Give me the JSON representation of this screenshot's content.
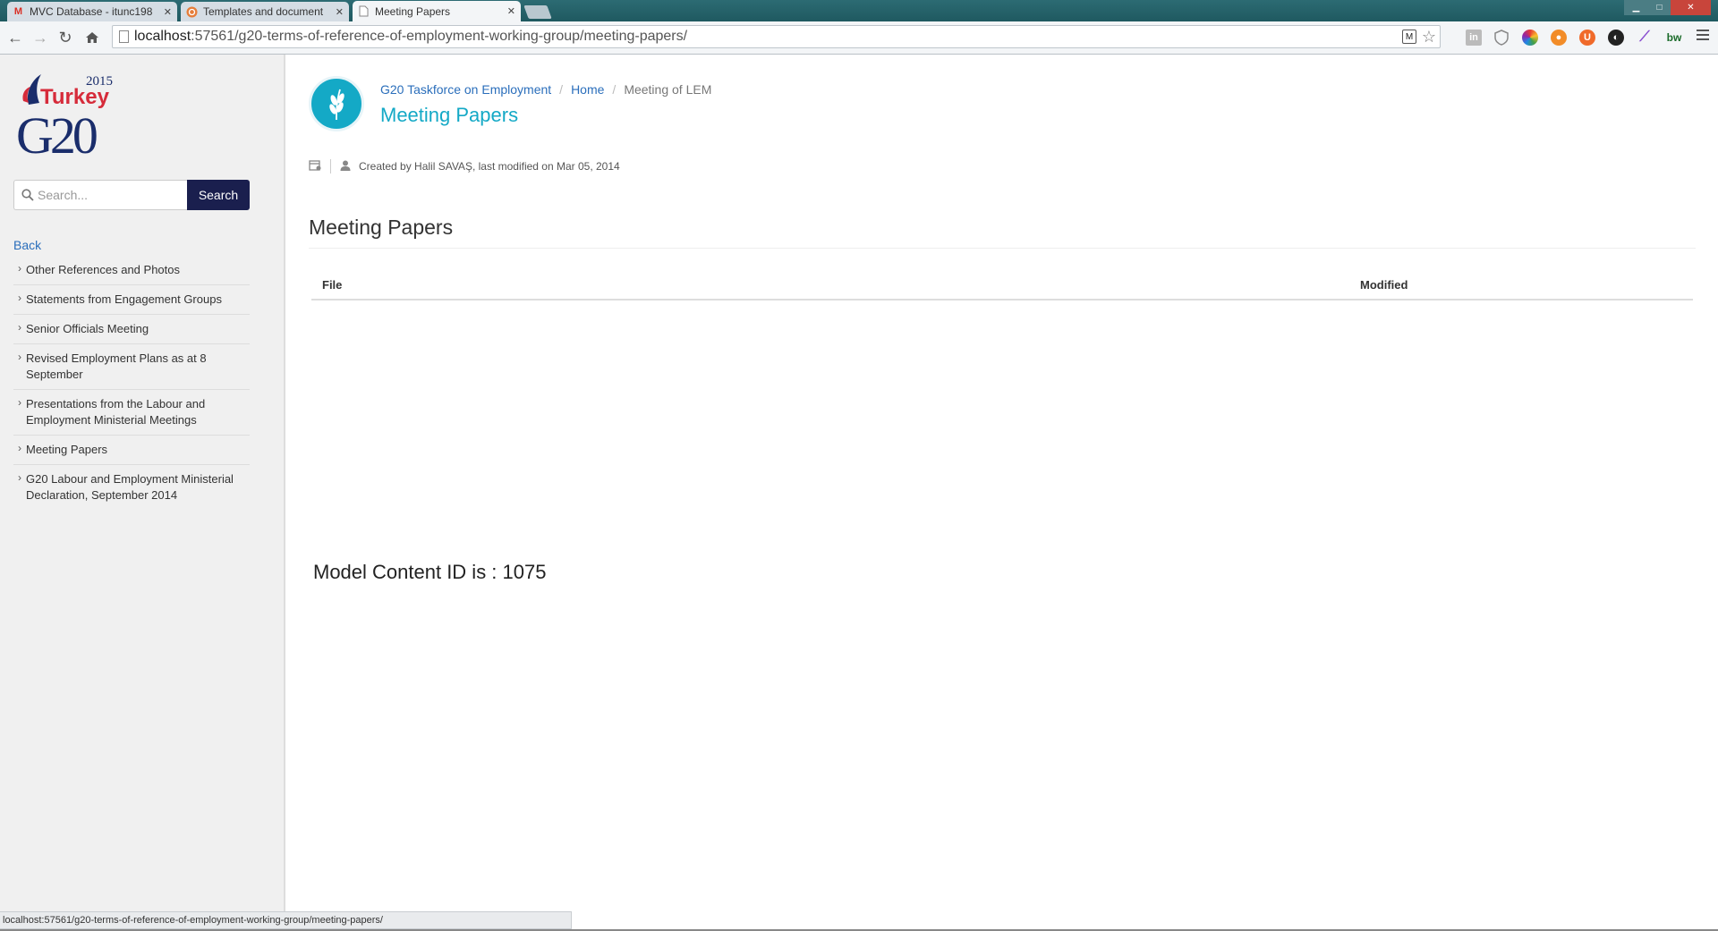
{
  "browser": {
    "tabs": [
      {
        "title": "MVC Database - itunc198",
        "favicon": "gmail-icon",
        "active": false
      },
      {
        "title": "Templates and document",
        "favicon": "umbraco-icon",
        "active": false
      },
      {
        "title": "Meeting Papers",
        "favicon": "page-icon",
        "active": true
      }
    ],
    "address": {
      "host": "localhost",
      "path": ":57561/g20-terms-of-reference-of-employment-working-group/meeting-papers/"
    },
    "status_url": "localhost:57561/g20-terms-of-reference-of-employment-working-group/meeting-papers/"
  },
  "sidebar": {
    "logo": {
      "year": "2015",
      "country": "Turkey",
      "mark": "G20"
    },
    "search": {
      "placeholder": "Search...",
      "button_label": "Search"
    },
    "back_label": "Back",
    "items": [
      {
        "label": "Other References and Photos"
      },
      {
        "label": "Statements from Engagement Groups"
      },
      {
        "label": "Senior Officials Meeting"
      },
      {
        "label": "Revised Employment Plans as at 8 September"
      },
      {
        "label": "Presentations from the Labour and Employment Ministerial Meetings"
      },
      {
        "label": "Meeting Papers"
      },
      {
        "label": "G20 Labour and Employment Ministerial Declaration, September 2014"
      }
    ]
  },
  "main": {
    "breadcrumb": {
      "space": "G20 Taskforce on Employment",
      "home": "Home",
      "current": "Meeting of LEM"
    },
    "title": "Meeting Papers",
    "meta_text": "Created by Halil SAVAŞ, last modified on Mar 05, 2014",
    "section_title": "Meeting Papers",
    "table": {
      "columns": [
        "File",
        "Modified"
      ]
    },
    "model_text": "Model Content ID is : 1075"
  },
  "colors": {
    "accent": "#14a9c6",
    "link": "#2a6ebb",
    "search_button": "#1a1f4e",
    "sidebar_bg": "#f0f0f0"
  }
}
